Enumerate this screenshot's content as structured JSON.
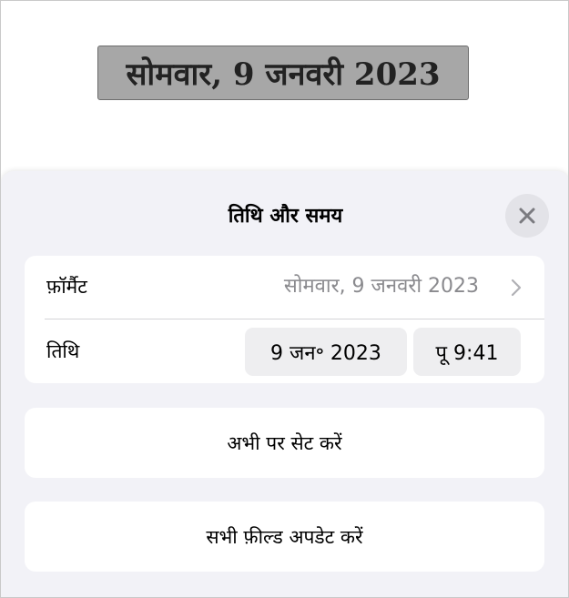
{
  "document": {
    "date_field_text": "सोमवार, 9 जनवरी 2023"
  },
  "sheet": {
    "title": "तिथि और समय",
    "close_icon": "close-icon",
    "format_row": {
      "label": "फ़ॉर्मैट",
      "value": "सोमवार, 9 जनवरी 2023",
      "icon": "chevron-right-icon"
    },
    "date_row": {
      "label": "तिथि",
      "date_value": "9 जन॰ 2023",
      "time_value": "पू 9:41"
    },
    "set_now_label": "अभी पर सेट करें",
    "update_all_label": "सभी फ़ील्ड अपडेट करें"
  },
  "colors": {
    "sheet_background": "#f2f2f7",
    "selected_field_background": "#a7a7a7",
    "secondary_text": "#8a8a8e",
    "pill_background": "#eeeef0"
  }
}
